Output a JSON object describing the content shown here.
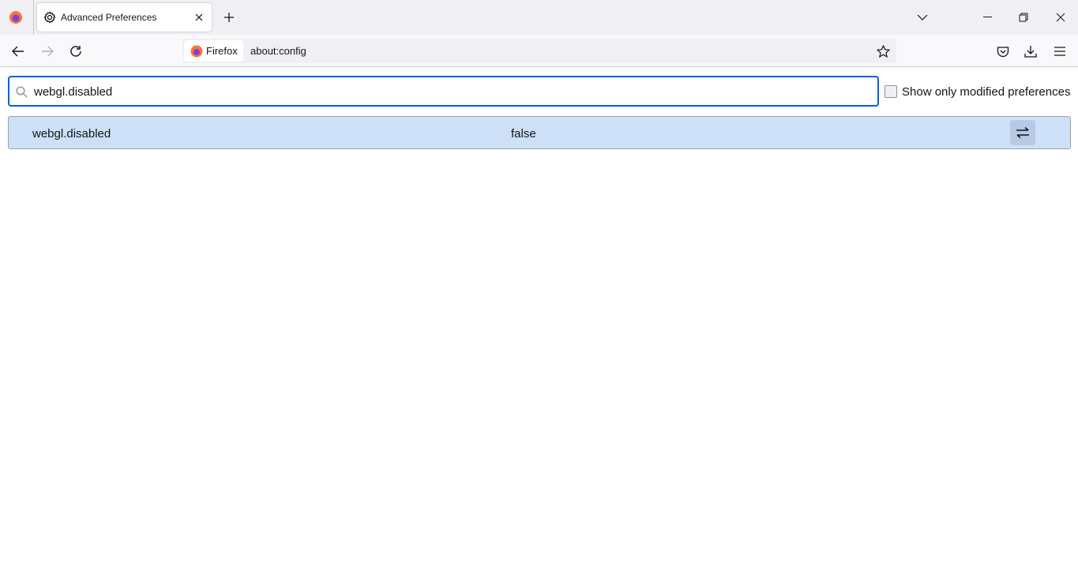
{
  "browser": {
    "tab_title": "Advanced Preferences",
    "identity_label": "Firefox",
    "url": "about:config"
  },
  "config": {
    "search_value": "webgl.disabled",
    "show_modified_label": "Show only modified preferences",
    "show_modified_checked": false,
    "rows": [
      {
        "name": "webgl.disabled",
        "value": "false"
      }
    ]
  },
  "colors": {
    "accent": "#0061e0",
    "row_bg": "#cde0f7"
  }
}
